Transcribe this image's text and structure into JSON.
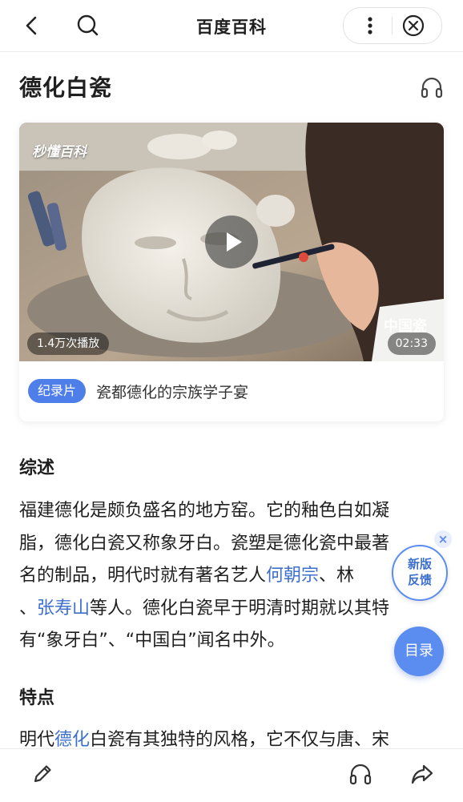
{
  "nav": {
    "title": "百度百科"
  },
  "article": {
    "title": "德化白瓷",
    "video": {
      "watermark": "秒懂百科",
      "play_count": "1.4万次播放",
      "duration": "02:33",
      "badge": "纪录片",
      "caption": "瓷都德化的宗族学子宴"
    },
    "overview": {
      "heading": "综述",
      "p1": "福建德化是颇负盛名的地方窑。它的釉色白如凝",
      "p2": "脂，德化白瓷又称象牙白。瓷塑是德化瓷中最著",
      "p3a": "名的制品，明代时就有著名艺人",
      "link1": "何朝宗",
      "p3b": "、林",
      "p4a": "、",
      "link2": "张寿山",
      "p4b": "等人。德化白瓷早于明清时期就以其特",
      "p5": "有“象牙白”、“中国白”闻名中外。"
    },
    "features": {
      "heading": "特点",
      "p1a": "明代",
      "link": "德化",
      "p1b": "白瓷有其独特的风格，它不仅与唐、宋"
    }
  },
  "floating": {
    "feedback_line1": "新版",
    "feedback_line2": "反馈",
    "feedback_close": "×",
    "toc": "目录"
  },
  "icons": {
    "back": "chevron-left-icon",
    "search": "search-icon",
    "more": "more-vertical-icon",
    "close": "close-circle-icon",
    "listen": "headphones-icon",
    "edit": "pencil-icon",
    "share": "share-icon",
    "play": "play-icon"
  },
  "colors": {
    "accent": "#5b8cf0",
    "link": "#3d6fcc",
    "badge": "#4e7ee9"
  }
}
